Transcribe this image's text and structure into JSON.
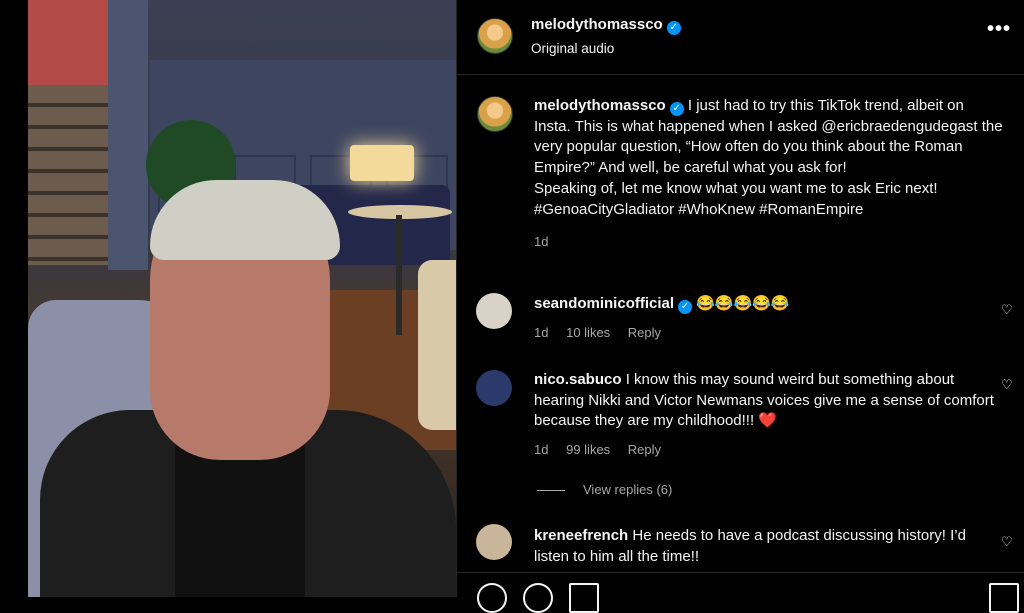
{
  "header": {
    "username": "melodythomassco",
    "subtitle": "Original audio",
    "verified_mark": "✓",
    "more_label": "•••"
  },
  "caption": {
    "username": "melodythomassco",
    "verified_mark": "✓",
    "text": "I just had to try this TikTok trend, albeit on Insta. This is what happened when I asked @ericbraedengudegast the very popular question, “How often do you think about the Roman Empire?” And well, be careful what you ask for!",
    "text2": "Speaking of, let me know what you want me to ask Eric next!",
    "hashtags": "#GenoaCityGladiator #WhoKnew #RomanEmpire",
    "age": "1d"
  },
  "comments": [
    {
      "username": "seandominicofficial",
      "verified_mark": "✓",
      "text": "😂😂😂😂😂",
      "age": "1d",
      "likes": "10 likes",
      "reply": "Reply"
    },
    {
      "username": "nico.sabuco",
      "text": "I know this may sound weird but something about hearing Nikki and Victor Newmans voices give me a sense of comfort because they are my childhood!!! ❤️",
      "age": "1d",
      "likes": "99 likes",
      "reply": "Reply",
      "view_replies": "View replies (6)"
    },
    {
      "username": "kreneefrench",
      "text": "He needs to have a podcast discussing history! I’d listen to him all the time!!"
    }
  ],
  "icons": {
    "like": "heart-icon",
    "more": "more-options-icon"
  },
  "colors": {
    "background": "#000000",
    "verified": "#0095f6",
    "muted": "#a8a8a8"
  }
}
